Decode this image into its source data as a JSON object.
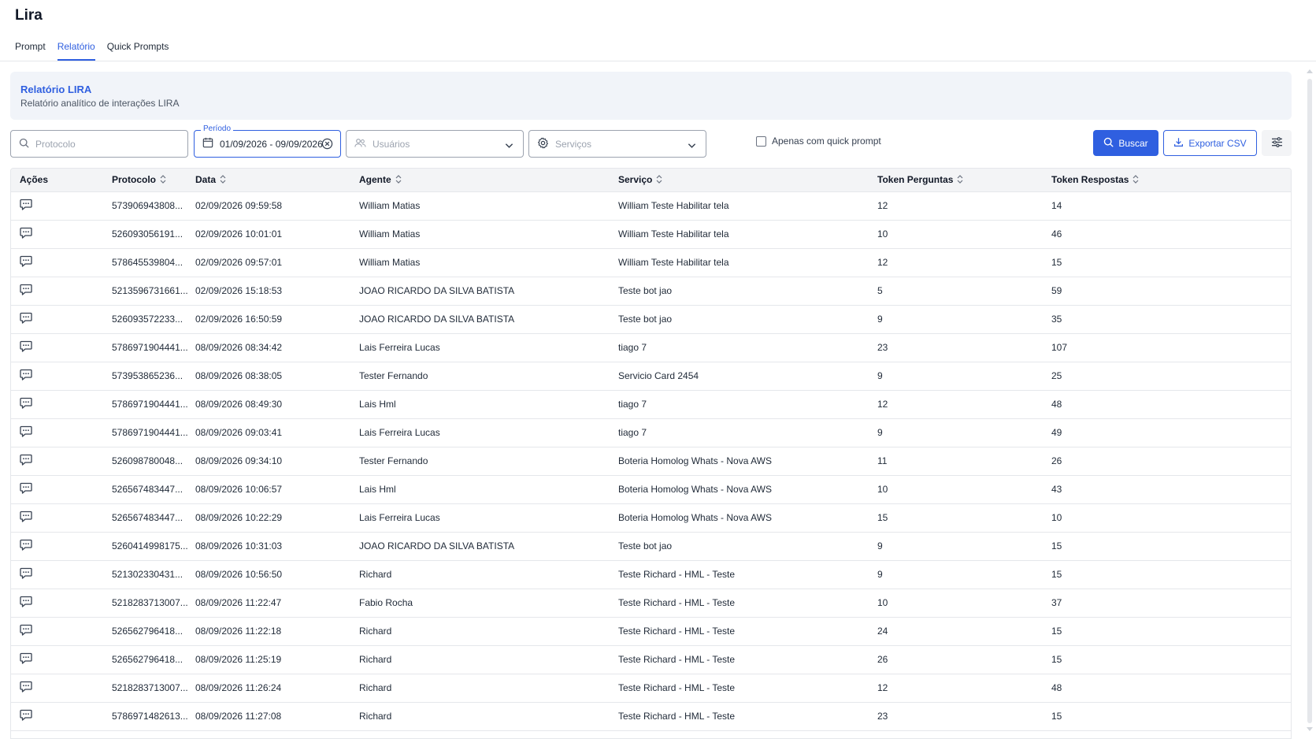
{
  "app": {
    "title": "Lira"
  },
  "tabs": [
    {
      "label": "Prompt",
      "active": false
    },
    {
      "label": "Relatório",
      "active": true
    },
    {
      "label": "Quick Prompts",
      "active": false
    }
  ],
  "banner": {
    "title": "Relatório LIRA",
    "subtitle": "Relatório analítico de interações LIRA"
  },
  "filters": {
    "protocolo_placeholder": "Protocolo",
    "periodo_label": "Período",
    "periodo_value": "01/09/2026 - 09/09/2026",
    "usuarios_placeholder": "Usuários",
    "servicos_placeholder": "Serviços",
    "quick_prompt_label": "Apenas com quick prompt",
    "quick_prompt_checked": false,
    "buscar_label": "Buscar",
    "exportar_label": "Exportar CSV"
  },
  "colors": {
    "accent": "#2f5fe0",
    "header_bg": "#f3f4f6",
    "banner_bg": "#f1f4f9"
  },
  "table": {
    "columns": [
      "Ações",
      "Protocolo",
      "Data",
      "Agente",
      "Serviço",
      "Token Perguntas",
      "Token Respostas"
    ],
    "rows": [
      [
        "573906943808...",
        "02/09/2026 09:59:58",
        "William Matias",
        "William Teste Habilitar tela",
        "12",
        "14"
      ],
      [
        "526093056191...",
        "02/09/2026 10:01:01",
        "William Matias",
        "William Teste Habilitar tela",
        "10",
        "46"
      ],
      [
        "578645539804...",
        "02/09/2026 09:57:01",
        "William Matias",
        "William Teste Habilitar tela",
        "12",
        "15"
      ],
      [
        "5213596731661...",
        "02/09/2026 15:18:53",
        "JOAO RICARDO DA SILVA BATISTA",
        "Teste bot jao",
        "5",
        "59"
      ],
      [
        "526093572233...",
        "02/09/2026 16:50:59",
        "JOAO RICARDO DA SILVA BATISTA",
        "Teste bot jao",
        "9",
        "35"
      ],
      [
        "5786971904441...",
        "08/09/2026 08:34:42",
        "Lais Ferreira Lucas",
        "tiago 7",
        "23",
        "107"
      ],
      [
        "573953865236...",
        "08/09/2026 08:38:05",
        "Tester Fernando",
        "Servicio Card 2454",
        "9",
        "25"
      ],
      [
        "5786971904441...",
        "08/09/2026 08:49:30",
        "Lais Hml",
        "tiago 7",
        "12",
        "48"
      ],
      [
        "5786971904441...",
        "08/09/2026 09:03:41",
        "Lais Ferreira Lucas",
        "tiago 7",
        "9",
        "49"
      ],
      [
        "526098780048...",
        "08/09/2026 09:34:10",
        "Tester Fernando",
        "Boteria Homolog Whats - Nova AWS",
        "11",
        "26"
      ],
      [
        "526567483447...",
        "08/09/2026 10:06:57",
        "Lais Hml",
        "Boteria Homolog Whats - Nova AWS",
        "10",
        "43"
      ],
      [
        "526567483447...",
        "08/09/2026 10:22:29",
        "Lais Ferreira Lucas",
        "Boteria Homolog Whats - Nova AWS",
        "15",
        "10"
      ],
      [
        "5260414998175...",
        "08/09/2026 10:31:03",
        "JOAO RICARDO DA SILVA BATISTA",
        "Teste bot jao",
        "9",
        "15"
      ],
      [
        "521302330431...",
        "08/09/2026 10:56:50",
        "Richard",
        "Teste Richard - HML - Teste",
        "9",
        "15"
      ],
      [
        "5218283713007...",
        "08/09/2026 11:22:47",
        "Fabio Rocha",
        "Teste Richard - HML - Teste",
        "10",
        "37"
      ],
      [
        "526562796418...",
        "08/09/2026 11:22:18",
        "Richard",
        "Teste Richard - HML - Teste",
        "24",
        "15"
      ],
      [
        "526562796418...",
        "08/09/2026 11:25:19",
        "Richard",
        "Teste Richard - HML - Teste",
        "26",
        "15"
      ],
      [
        "5218283713007...",
        "08/09/2026 11:26:24",
        "Richard",
        "Teste Richard - HML - Teste",
        "12",
        "48"
      ],
      [
        "5786971482613...",
        "08/09/2026 11:27:08",
        "Richard",
        "Teste Richard - HML - Teste",
        "23",
        "15"
      ]
    ]
  }
}
